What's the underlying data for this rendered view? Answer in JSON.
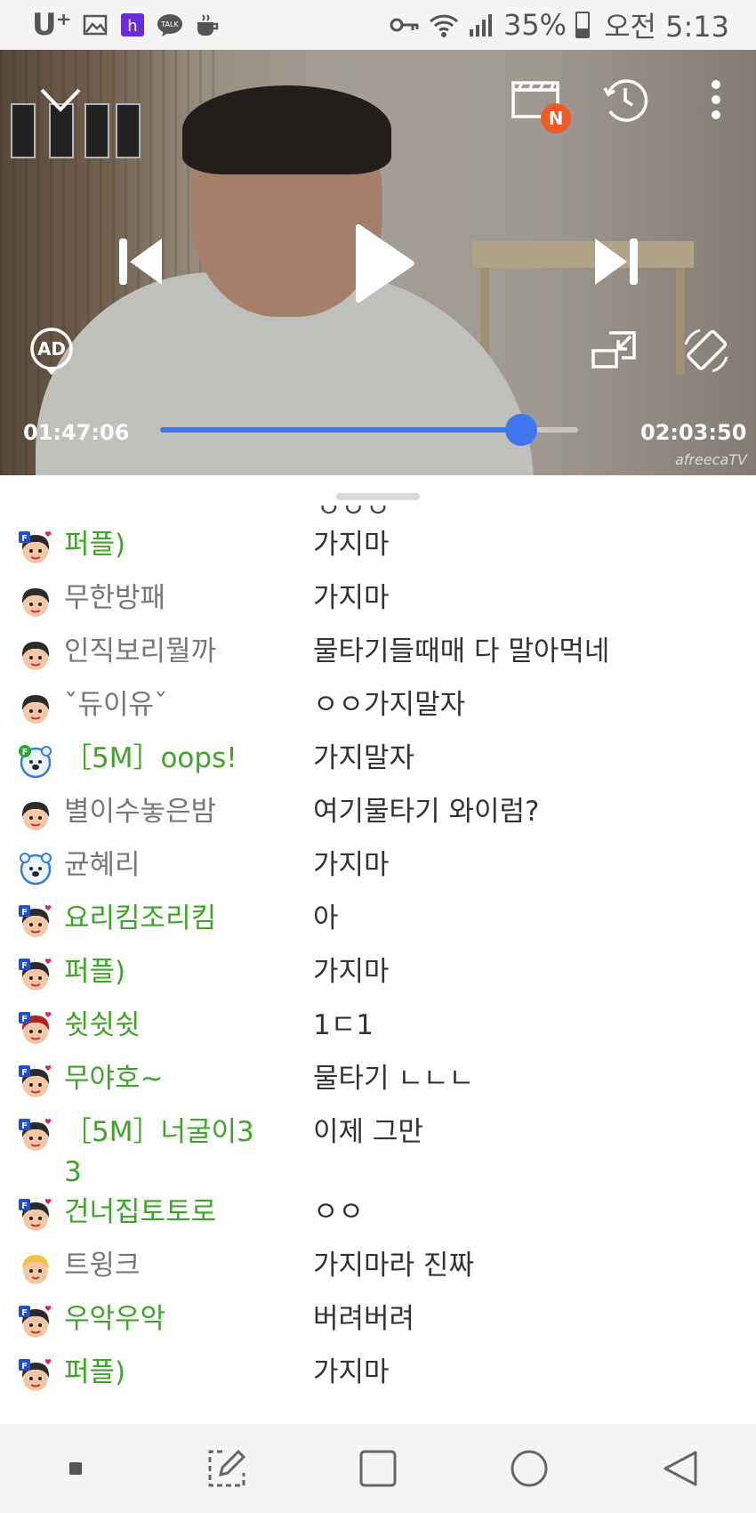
{
  "status_bar": {
    "carrier": "U⁺",
    "battery": "35%",
    "time": "오전 5:13"
  },
  "player": {
    "elapsed": "01:47:06",
    "duration": "02:03:50",
    "progress": 0.8648,
    "watermark": "afreecaTV",
    "new_badge": "N",
    "ad_label": "AD",
    "accent_color": "#3f75ef",
    "badge_color": "#f05a24"
  },
  "chat": {
    "fan_color": "#3ea626",
    "normal_color": "#777777",
    "messages": [
      {
        "nick": "퍼플)",
        "text": "가지마",
        "fan": true,
        "avatar": "fan-face"
      },
      {
        "nick": "무한방패",
        "text": "가지마",
        "fan": false,
        "avatar": "face"
      },
      {
        "nick": "인직보리뭘까",
        "text": "물타기들때매 다 말아먹네",
        "fan": false,
        "avatar": "face"
      },
      {
        "nick": "ˇ듀이유ˇ",
        "text": "ㅇㅇ가지말자",
        "fan": false,
        "avatar": "face"
      },
      {
        "nick": "［5M］oops!",
        "text": "가지말자",
        "fan": true,
        "avatar": "fan-bear"
      },
      {
        "nick": "별이수놓은밤",
        "text": "여기물타기 와이럼?",
        "fan": false,
        "avatar": "face"
      },
      {
        "nick": "균혜리",
        "text": "가지마",
        "fan": false,
        "avatar": "bear"
      },
      {
        "nick": "요리킴조리킴",
        "text": "아",
        "fan": true,
        "avatar": "fan-face"
      },
      {
        "nick": "퍼플)",
        "text": "가지마",
        "fan": true,
        "avatar": "fan-face"
      },
      {
        "nick": "쉿쉿쉿",
        "text": "1ㄷ1",
        "fan": true,
        "avatar": "fan-red"
      },
      {
        "nick": "무야호~",
        "text": "물타기 ㄴㄴㄴ",
        "fan": true,
        "avatar": "fan-face"
      },
      {
        "nick": "［5M］너굴이3\n3",
        "text": "이제 그만",
        "fan": true,
        "avatar": "fan-face"
      },
      {
        "nick": "건너집토토로",
        "text": "ㅇㅇ",
        "fan": true,
        "avatar": "fan-face"
      },
      {
        "nick": "트윙크",
        "text": "가지마라 진짜",
        "fan": false,
        "avatar": "blonde"
      },
      {
        "nick": "우악우악",
        "text": "버려버려",
        "fan": true,
        "avatar": "fan-face"
      },
      {
        "nick": "퍼플)",
        "text": "가지마",
        "fan": true,
        "avatar": "fan-face"
      }
    ]
  },
  "icons": {
    "collapse": "chevron-down-icon",
    "clip": "clapperboard-icon",
    "history": "clock-history-icon",
    "more": "more-vertical-icon",
    "prev": "skip-previous-icon",
    "play": "play-icon",
    "next": "skip-next-icon",
    "pip": "picture-in-picture-icon",
    "rotate": "screen-rotate-icon"
  }
}
